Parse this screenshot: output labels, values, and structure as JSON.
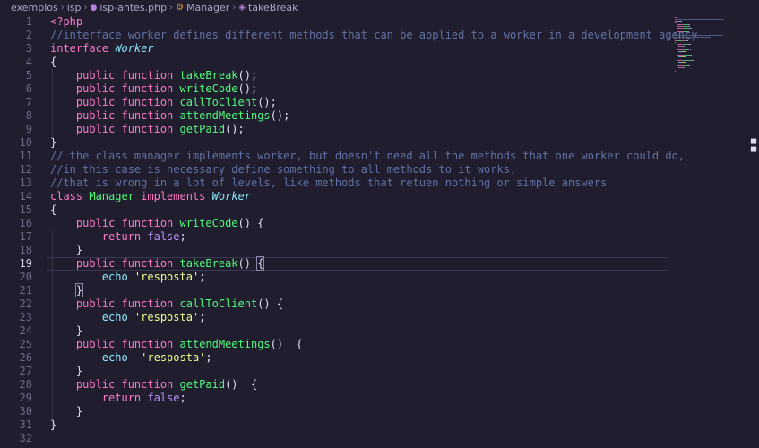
{
  "breadcrumb": {
    "items": [
      "exemplos",
      "isp",
      "isp-antes.php",
      "Manager",
      "takeBreak"
    ]
  },
  "editor": {
    "active_line": 19,
    "lines": [
      {
        "n": "1",
        "tokens": [
          {
            "t": "<?php",
            "c": "k"
          }
        ]
      },
      {
        "n": "2",
        "tokens": [
          {
            "t": "//interface worker defines different methods that can be applied to a worker in a development agency",
            "c": "c"
          }
        ]
      },
      {
        "n": "3",
        "tokens": [
          {
            "t": "interface ",
            "c": "k"
          },
          {
            "t": "Worker",
            "c": "t"
          }
        ]
      },
      {
        "n": "4",
        "tokens": [
          {
            "t": "{",
            "c": "br"
          }
        ]
      },
      {
        "n": "5",
        "tokens": [
          {
            "t": "    public function ",
            "c": "k"
          },
          {
            "t": "takeBreak",
            "c": "f"
          },
          {
            "t": "();",
            "c": "br"
          }
        ]
      },
      {
        "n": "6",
        "tokens": [
          {
            "t": "    public function ",
            "c": "k"
          },
          {
            "t": "writeCode",
            "c": "f"
          },
          {
            "t": "();",
            "c": "br"
          }
        ]
      },
      {
        "n": "7",
        "tokens": [
          {
            "t": "    public function ",
            "c": "k"
          },
          {
            "t": "callToClient",
            "c": "f"
          },
          {
            "t": "();",
            "c": "br"
          }
        ]
      },
      {
        "n": "8",
        "tokens": [
          {
            "t": "    public function ",
            "c": "k"
          },
          {
            "t": "attendMeetings",
            "c": "f"
          },
          {
            "t": "();",
            "c": "br"
          }
        ]
      },
      {
        "n": "9",
        "tokens": [
          {
            "t": "    public function ",
            "c": "k"
          },
          {
            "t": "getPaid",
            "c": "f"
          },
          {
            "t": "();",
            "c": "br"
          }
        ]
      },
      {
        "n": "10",
        "tokens": [
          {
            "t": "}",
            "c": "br"
          }
        ]
      },
      {
        "n": "11",
        "tokens": [
          {
            "t": "// the class manager implements worker, but doesn't need all the methods that one worker could do,",
            "c": "c"
          }
        ]
      },
      {
        "n": "12",
        "tokens": [
          {
            "t": "//in this case is necessary define something to all methods to it works,",
            "c": "c"
          }
        ]
      },
      {
        "n": "13",
        "tokens": [
          {
            "t": "//that is wrong in a lot of levels, like methods that retuen nothing or simple answers",
            "c": "c"
          }
        ]
      },
      {
        "n": "14",
        "tokens": [
          {
            "t": "class ",
            "c": "k"
          },
          {
            "t": "Manager ",
            "c": "f"
          },
          {
            "t": "implements ",
            "c": "k"
          },
          {
            "t": "Worker",
            "c": "t"
          }
        ]
      },
      {
        "n": "15",
        "tokens": [
          {
            "t": "{",
            "c": "br"
          }
        ]
      },
      {
        "n": "16",
        "tokens": [
          {
            "t": "    public function ",
            "c": "k"
          },
          {
            "t": "writeCode",
            "c": "f"
          },
          {
            "t": "() {",
            "c": "br"
          }
        ]
      },
      {
        "n": "17",
        "tokens": [
          {
            "t": "        return ",
            "c": "k"
          },
          {
            "t": "false",
            "c": "kw"
          },
          {
            "t": ";",
            "c": "br"
          }
        ]
      },
      {
        "n": "18",
        "tokens": [
          {
            "t": "    }",
            "c": "br"
          }
        ]
      },
      {
        "n": "19",
        "tokens": [
          {
            "t": "    public function ",
            "c": "k"
          },
          {
            "t": "takeBreak",
            "c": "f"
          },
          {
            "t": "() ",
            "c": "br"
          },
          {
            "t": "{",
            "c": "br hl-br"
          }
        ]
      },
      {
        "n": "20",
        "tokens": [
          {
            "t": "        echo ",
            "c": "ec"
          },
          {
            "t": "'resposta'",
            "c": "s"
          },
          {
            "t": ";",
            "c": "br"
          }
        ]
      },
      {
        "n": "21",
        "tokens": [
          {
            "t": "    ",
            "c": "br"
          },
          {
            "t": "}",
            "c": "br hl-br"
          }
        ]
      },
      {
        "n": "22",
        "tokens": [
          {
            "t": "    public function ",
            "c": "k"
          },
          {
            "t": "callToClient",
            "c": "f"
          },
          {
            "t": "() {",
            "c": "br"
          }
        ]
      },
      {
        "n": "23",
        "tokens": [
          {
            "t": "        echo ",
            "c": "ec"
          },
          {
            "t": "'resposta'",
            "c": "s"
          },
          {
            "t": ";",
            "c": "br"
          }
        ]
      },
      {
        "n": "24",
        "tokens": [
          {
            "t": "    }",
            "c": "br"
          }
        ]
      },
      {
        "n": "25",
        "tokens": [
          {
            "t": "    public function ",
            "c": "k"
          },
          {
            "t": "attendMeetings",
            "c": "f"
          },
          {
            "t": "()  {",
            "c": "br"
          }
        ]
      },
      {
        "n": "26",
        "tokens": [
          {
            "t": "        echo  ",
            "c": "ec"
          },
          {
            "t": "'resposta'",
            "c": "s"
          },
          {
            "t": ";",
            "c": "br"
          }
        ]
      },
      {
        "n": "27",
        "tokens": [
          {
            "t": "    }",
            "c": "br"
          }
        ]
      },
      {
        "n": "28",
        "tokens": [
          {
            "t": "    public function ",
            "c": "k"
          },
          {
            "t": "getPaid",
            "c": "f"
          },
          {
            "t": "()  {",
            "c": "br"
          }
        ]
      },
      {
        "n": "29",
        "tokens": [
          {
            "t": "        return ",
            "c": "k"
          },
          {
            "t": "false",
            "c": "kw"
          },
          {
            "t": ";",
            "c": "br"
          }
        ]
      },
      {
        "n": "30",
        "tokens": [
          {
            "t": "    }",
            "c": "br"
          }
        ]
      },
      {
        "n": "31",
        "tokens": [
          {
            "t": "}",
            "c": "br"
          }
        ]
      },
      {
        "n": "32",
        "tokens": []
      }
    ]
  },
  "colors": {
    "background": "#1f1d2e",
    "keyword": "#ff79c6",
    "function": "#50fa7b",
    "comment": "#6272a4",
    "type": "#8be9fd",
    "string": "#f1fa8c"
  }
}
